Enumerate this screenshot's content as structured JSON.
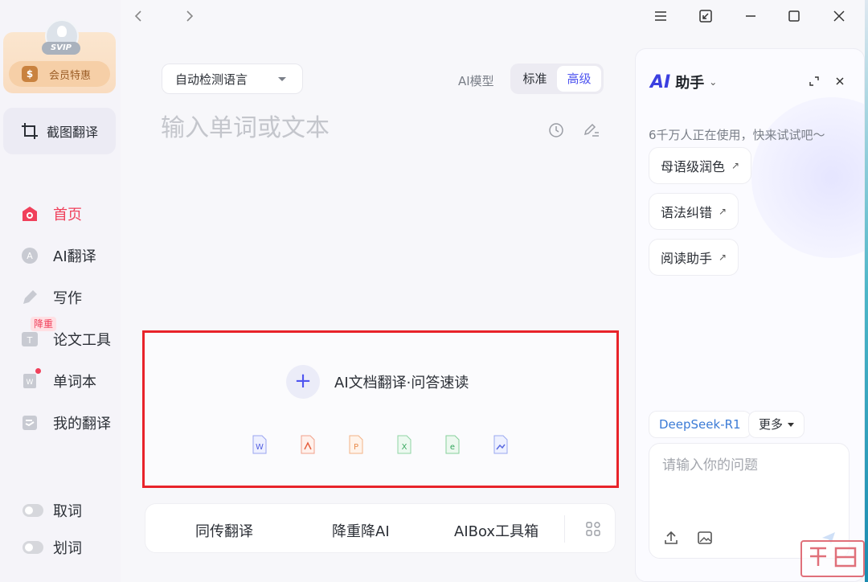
{
  "sidebar": {
    "svip_tag": "SVIP",
    "member_label": "会员特惠",
    "capture_label": "截图翻译",
    "nav": [
      {
        "label": "首页",
        "icon": "home-icon"
      },
      {
        "label": "AI翻译",
        "icon": "ai-translate-icon"
      },
      {
        "label": "写作",
        "icon": "pen-icon"
      },
      {
        "label": "论文工具",
        "icon": "thesis-icon",
        "badge": "降重"
      },
      {
        "label": "单词本",
        "icon": "wordbook-icon"
      },
      {
        "label": "我的翻译",
        "icon": "my-translation-icon"
      }
    ],
    "toggles": [
      {
        "label": "取词"
      },
      {
        "label": "划词"
      }
    ]
  },
  "main": {
    "lang_select": "自动检测语言",
    "ai_model_label": "AI模型",
    "model_options": [
      "标准",
      "高级"
    ],
    "model_selected": "高级",
    "input_placeholder": "输入单词或文本",
    "doc_label": "AI文档翻译·问答速读",
    "doc_types": [
      "word-file-icon",
      "pdf-file-icon",
      "ppt-file-icon",
      "excel-file-icon",
      "epub-file-icon",
      "image-file-icon"
    ],
    "bottom_tools": [
      "同传翻译",
      "降重降AI",
      "AIBox工具箱"
    ]
  },
  "ai_panel": {
    "logo": "AI",
    "title": "助手",
    "subtitle": "6千万人正在使用，快来试试吧～",
    "chips": [
      "母语级润色",
      "语法纠错",
      "阅读助手"
    ],
    "model": "DeepSeek-R1",
    "more": "更多",
    "ask_placeholder": "请输入你的问题"
  },
  "colors": {
    "accent": "#4f55f0",
    "active": "#f0405b",
    "highlight_border": "#e8232a"
  }
}
